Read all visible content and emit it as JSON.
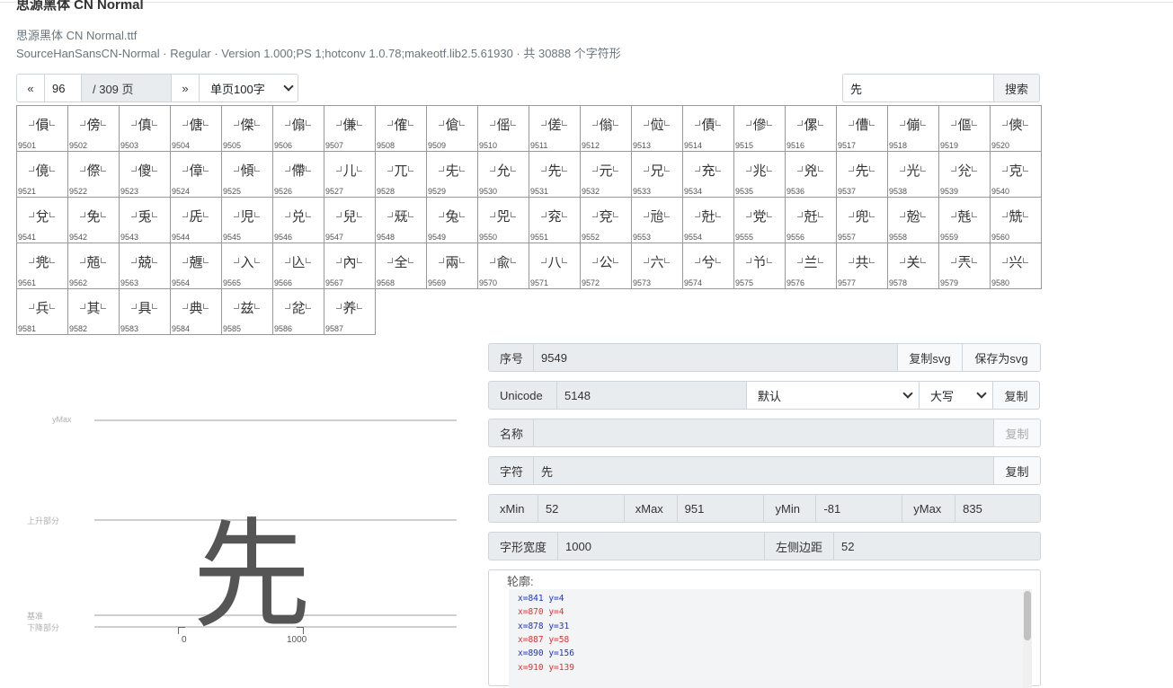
{
  "header": {
    "title": "思源黑体 CN Normal",
    "file": "思源黑体 CN Normal.ttf",
    "meta": "SourceHanSansCN-Normal · Regular · Version 1.000;PS 1;hotconv 1.0.78;makeotf.lib2.5.61930 · 共 30888 个字符形"
  },
  "pager": {
    "prev": "«",
    "page": "96",
    "total": "/ 309 页",
    "next": "»",
    "per_page": "单页100字"
  },
  "search": {
    "value": "先",
    "button": "搜索"
  },
  "grid": {
    "glyphs": "傊傍傎傏傑傓傔傕傖傜傞傟傡債傪傫傮傰傴傸傹傺傻傽傾僀儿兀兂允先元兄充兆兇先光兊克兌免兎兏児兑兒兓兔兕兖兗兘兙党兛兜兝兞兟兠兡兢兣入兦內全兩兪八公六兮兯兰共关兲兴兵其具典兹兺养"
  },
  "preview": {
    "glyph": "先",
    "labels": {
      "ymax": "yMax",
      "ascender": "上升部分",
      "baseline": "基准",
      "descender": "下降部分"
    },
    "ticks": {
      "start": "0",
      "end": "1000"
    }
  },
  "details": {
    "index_label": "序号",
    "index_value": "9549",
    "copy_svg": "复制svg",
    "save_svg": "保存为svg",
    "unicode_label": "Unicode",
    "unicode_value": "5148",
    "format_select": "默认",
    "case_select": "大写",
    "copy": "复制",
    "name_label": "名称",
    "name_value": "",
    "char_label": "字符",
    "char_value": "先",
    "xmin_label": "xMin",
    "xmin_value": "52",
    "xmax_label": "xMax",
    "xmax_value": "951",
    "ymin_label": "yMin",
    "ymin_value": "-81",
    "ymax_label": "yMax",
    "ymax_value": "835",
    "advance_label": "字形宽度",
    "advance_value": "1000",
    "lsb_label": "左侧边距",
    "lsb_value": "52"
  },
  "outline": {
    "title": "轮廓:",
    "points": [
      {
        "text": "x=841 y=4",
        "on": true
      },
      {
        "text": "x=870 y=4",
        "on": false
      },
      {
        "text": "x=878 y=31",
        "on": true
      },
      {
        "text": "x=887 y=58",
        "on": false
      },
      {
        "text": "x=890 y=156",
        "on": true
      },
      {
        "text": "x=910 y=139",
        "on": false
      }
    ]
  },
  "colors": {
    "on_curve": "#2233bb",
    "off_curve": "#dd3333"
  }
}
